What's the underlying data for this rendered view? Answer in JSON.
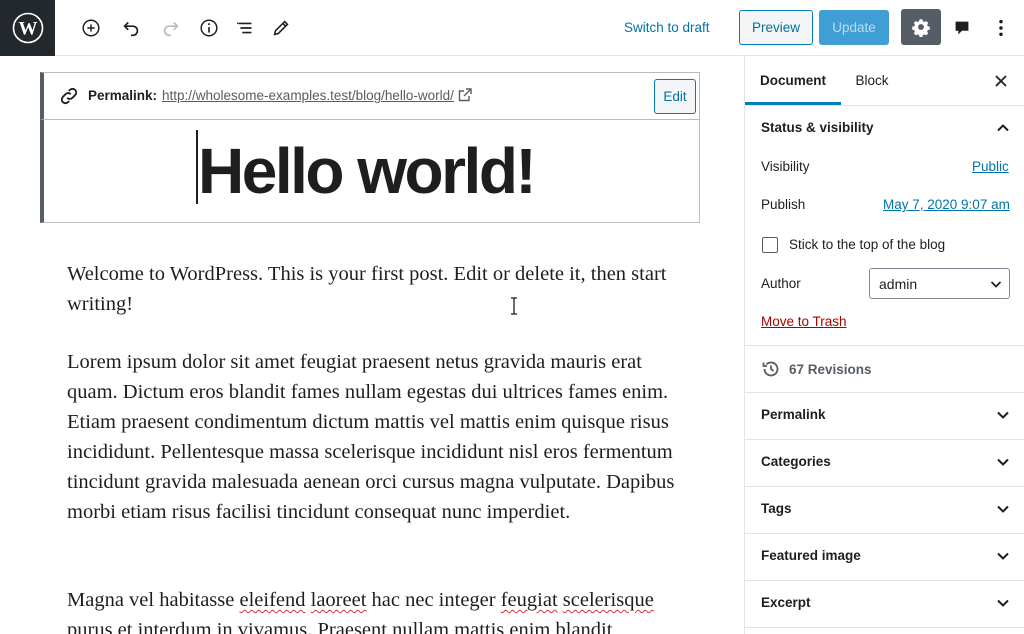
{
  "toolbar": {
    "switch_to_draft": "Switch to draft",
    "preview": "Preview",
    "update": "Update"
  },
  "permalink": {
    "label": "Permalink:",
    "url": "http://wholesome-examples.test/blog/hello-world/",
    "edit": "Edit"
  },
  "post": {
    "title": "Hello world!",
    "p1": "Welcome to WordPress. This is your first post. Edit or delete it, then start writing!",
    "p2": "Lorem ipsum dolor sit amet feugiat praesent netus gravida mauris erat quam. Dictum eros blandit fames nullam egestas dui ultrices fames enim. Etiam praesent condimentum dictum mattis vel mattis enim quisque risus incididunt. Pellentesque massa scelerisque incididunt nisl eros fermentum tincidunt gravida malesuada aenean orci cursus magna vulputate. Dapibus morbi etiam risus facilisi tincidunt consequat nunc imperdiet.",
    "p3": {
      "w1": "Magna vel habitasse ",
      "w2": "eleifend",
      "w3": " ",
      "w4": "laoreet",
      "w5": " hac nec integer ",
      "w6": "feugiat",
      "w7": " ",
      "w8": "scelerisque",
      "w9": " purus et interdum in vivamus. Praesent nullam mattis enim blandit"
    }
  },
  "sidebar": {
    "tabs": {
      "document": "Document",
      "block": "Block"
    },
    "status_visibility": {
      "title": "Status & visibility",
      "visibility_label": "Visibility",
      "visibility_value": "Public",
      "publish_label": "Publish",
      "publish_value": "May 7, 2020 9:07 am",
      "sticky_label": "Stick to the top of the blog",
      "author_label": "Author",
      "author_value": "admin",
      "trash": "Move to Trash"
    },
    "revisions": "67 Revisions",
    "panels": {
      "permalink": "Permalink",
      "categories": "Categories",
      "tags": "Tags",
      "featured_image": "Featured image",
      "excerpt": "Excerpt"
    }
  },
  "colors": {
    "accent": "#007cba",
    "link": "#0073aa",
    "danger": "#aa0000",
    "toolbar_dark": "#23282d"
  }
}
